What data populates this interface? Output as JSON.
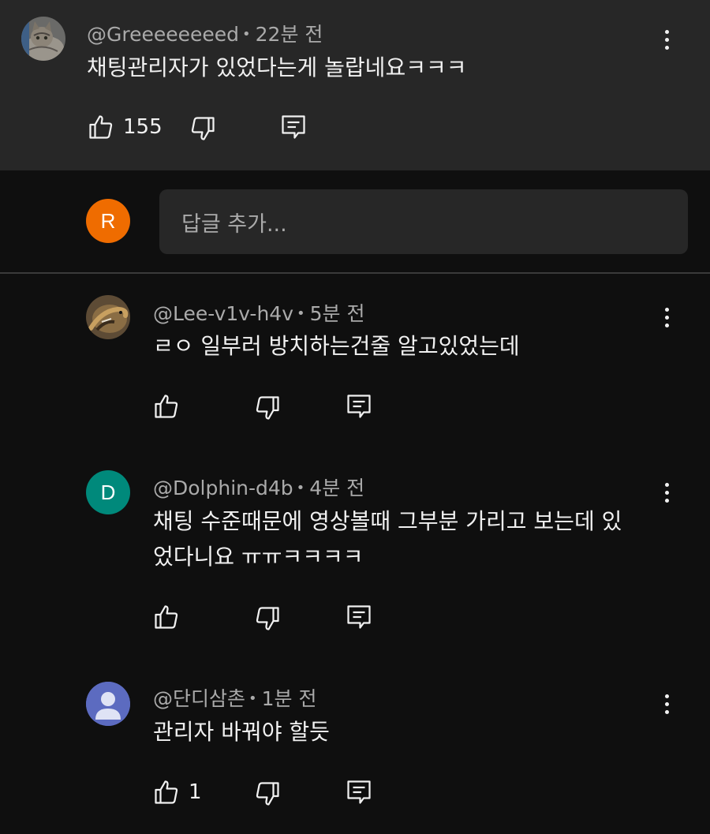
{
  "top_comment": {
    "author": "@Greeeeeeeed",
    "time": "22분 전",
    "text": "채팅관리자가 있었다는게 놀랍네요ㅋㅋㅋ",
    "likes": "155"
  },
  "reply_box": {
    "avatar_letter": "R",
    "placeholder": "답글 추가..."
  },
  "replies": [
    {
      "author": "@Lee-v1v-h4v",
      "time": "5분 전",
      "text_lines": [
        "ㄹㅇ 일부러 방치하는건줄 알고있었는데"
      ],
      "likes": ""
    },
    {
      "author": "@Dolphin-d4b",
      "time": "4분 전",
      "avatar_letter": "D",
      "text_lines": [
        "채팅 수준때문에 영상볼때 그부분 가리고 보는데 있",
        "었다니요 ㅠㅠㅋㅋㅋㅋ"
      ],
      "likes": ""
    },
    {
      "author": "@단디삼촌",
      "time": "1분 전",
      "text_lines": [
        "관리자 바꿔야 할듯"
      ],
      "likes": "1"
    }
  ],
  "colors": {
    "page_bg": "#0f0f0f",
    "highlight_bg": "#272727",
    "reply_avatar_orange": "#ef6c00",
    "dolphin_avatar_teal": "#00897b",
    "default_avatar_blue": "#5c6bc0"
  },
  "icons": [
    "thumbs-up-icon",
    "thumbs-down-icon",
    "reply-icon",
    "more-vert-icon"
  ]
}
